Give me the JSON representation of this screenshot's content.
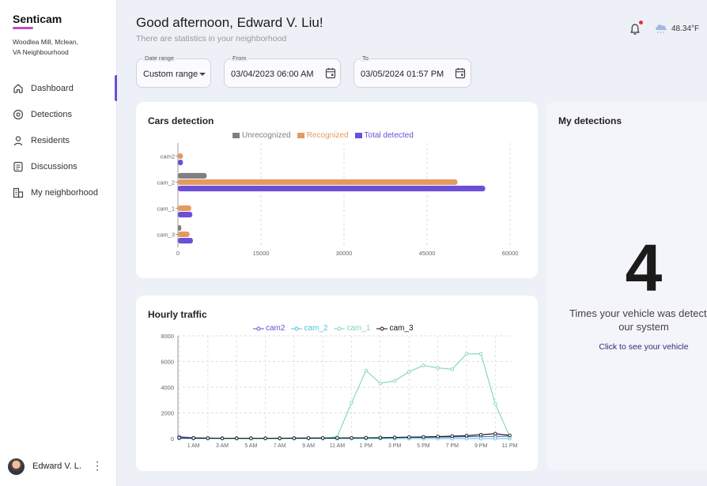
{
  "sidebar": {
    "brand": "Senticam",
    "location": [
      "Woodlea Mill, Mclean,",
      "VA Neighbourhood"
    ],
    "items": [
      {
        "label": "Dashboard",
        "icon": "home-icon",
        "active": true
      },
      {
        "label": "Detections",
        "icon": "detections-icon"
      },
      {
        "label": "Residents",
        "icon": "person-icon"
      },
      {
        "label": "Discussions",
        "icon": "document-icon"
      },
      {
        "label": "My neighborhood",
        "icon": "buildings-icon"
      }
    ],
    "user": {
      "name": "Edward V. L.",
      "menu": "⋮"
    }
  },
  "header": {
    "greeting": "Good afternoon, Edward V. Liu!",
    "subtitle": "There are statistics in your neighborhood",
    "temperature": "48.34°F"
  },
  "filters": {
    "date_range": {
      "label": "Date range",
      "value": "Custom range"
    },
    "from": {
      "label": "From",
      "value": "03/04/2023 06:00 AM"
    },
    "to": {
      "label": "To",
      "value": "03/05/2024 01:57 PM"
    }
  },
  "cars_card": {
    "title": "Cars detection"
  },
  "traffic_card": {
    "title": "Hourly traffic"
  },
  "my_detections": {
    "title": "My detections",
    "count": "4",
    "caption": "Times your vehicle was detected\nour system",
    "link": "Click to see your vehicle"
  },
  "colors": {
    "accent": "#6b4fd8",
    "unrecognized": "#808080",
    "recognized": "#e6995f",
    "total": "#6b4fd8"
  },
  "chart_data": [
    {
      "type": "bar",
      "orientation": "horizontal",
      "title": "Cars detection",
      "categories": [
        "cam2",
        "cam_2",
        "cam_1",
        "cam_3"
      ],
      "series": [
        {
          "name": "Unrecognized",
          "color": "#808080",
          "values": [
            0,
            5200,
            0,
            600
          ]
        },
        {
          "name": "Recognized",
          "color": "#e6995f",
          "values": [
            900,
            50500,
            2400,
            2100
          ]
        },
        {
          "name": "Total detected",
          "color": "#6b4fd8",
          "values": [
            900,
            55500,
            2600,
            2700
          ]
        }
      ],
      "xlim": [
        0,
        60000
      ],
      "xticks": [
        "0",
        "15000",
        "30000",
        "45000",
        "60000"
      ],
      "grid": true,
      "legend": "top"
    },
    {
      "type": "line",
      "title": "Hourly traffic",
      "x": [
        "12 AM",
        "1 AM",
        "2 AM",
        "3 AM",
        "4 AM",
        "5 AM",
        "6 AM",
        "7 AM",
        "8 AM",
        "9 AM",
        "10 AM",
        "11 AM",
        "12 PM",
        "1 PM",
        "2 PM",
        "3 PM",
        "4 PM",
        "5 PM",
        "6 PM",
        "7 PM",
        "8 PM",
        "9 PM",
        "10 PM",
        "11 PM"
      ],
      "xtick_labels": [
        "1 AM",
        "3 AM",
        "5 AM",
        "7 AM",
        "9 AM",
        "11 AM",
        "1 PM",
        "3 PM",
        "5 PM",
        "7 PM",
        "9 PM",
        "11 PM"
      ],
      "series": [
        {
          "name": "cam2",
          "color": "#6b4fd8",
          "values": [
            150,
            60,
            40,
            30,
            30,
            30,
            30,
            30,
            40,
            40,
            40,
            40,
            50,
            60,
            70,
            80,
            90,
            100,
            110,
            130,
            150,
            160,
            170,
            180
          ]
        },
        {
          "name": "cam_2",
          "color": "#4fc3d9",
          "values": [
            0,
            0,
            0,
            0,
            0,
            0,
            0,
            0,
            0,
            0,
            0,
            0,
            0,
            0,
            0,
            0,
            0,
            0,
            0,
            0,
            0,
            0,
            0,
            0
          ]
        },
        {
          "name": "cam_1",
          "color": "#7fd4c4",
          "values": [
            50,
            30,
            20,
            20,
            20,
            20,
            20,
            20,
            20,
            20,
            20,
            150,
            2800,
            5300,
            4300,
            4500,
            5200,
            5700,
            5500,
            5400,
            6600,
            6600,
            2700,
            150
          ]
        },
        {
          "name": "cam_3",
          "color": "#111111",
          "values": [
            60,
            40,
            30,
            20,
            20,
            20,
            20,
            20,
            30,
            40,
            40,
            40,
            50,
            60,
            70,
            90,
            110,
            130,
            160,
            190,
            230,
            300,
            380,
            250
          ]
        }
      ],
      "ylim": [
        0,
        8000
      ],
      "yticks": [
        "0",
        "2000",
        "4000",
        "6000",
        "8000"
      ],
      "grid": true,
      "legend": "top"
    }
  ]
}
